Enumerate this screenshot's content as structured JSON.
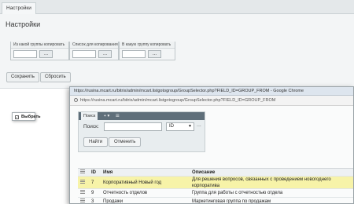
{
  "admin": {
    "tab": "Настройки",
    "title": "Настройки",
    "columns": [
      {
        "label": "Из какой группы копировать",
        "button": "..."
      },
      {
        "label": "Список для копирования",
        "button": "..."
      },
      {
        "label": "В какую группу копировать",
        "button": "..."
      }
    ],
    "save_label": "Сохранить",
    "reset_label": "Сбросить"
  },
  "popup": {
    "window_title": "https://rusina.mcart.ru/bitrix/admin/mcart.listgotogroup/GroupSelector.php?FIELD_ID=GROUP_FROM - Google Chrome",
    "address": "https://rusina.mcart.ru/bitrix/admin/mcart.listgotogroup/GroupSelector.php?FIELD_ID=GROUP_FROM",
    "filter": {
      "tab_label": "Поиск",
      "tab_extra": "+ ▾",
      "search_label": "Поиск:",
      "search_value": "",
      "field_select": "ID",
      "more": "...",
      "find_label": "Найти",
      "cancel_label": "Отменить"
    },
    "grid": {
      "headers": {
        "id": "ID",
        "name": "Имя",
        "description": "Описание"
      },
      "rows": [
        {
          "id": "7",
          "name": "Корпоративный Новый год",
          "description": "Для решения вопросов, связанных с проведением новогоднего корпоратива",
          "highlighted": true
        },
        {
          "id": "9",
          "name": "Отчетность отделов",
          "description": "Группа для работы с отчетностью отдела",
          "highlighted": false
        },
        {
          "id": "3",
          "name": "Продажи",
          "description": "Маркетинговая группа по продажам",
          "highlighted": false
        }
      ],
      "context_menu_item": "Выбрать"
    }
  }
}
